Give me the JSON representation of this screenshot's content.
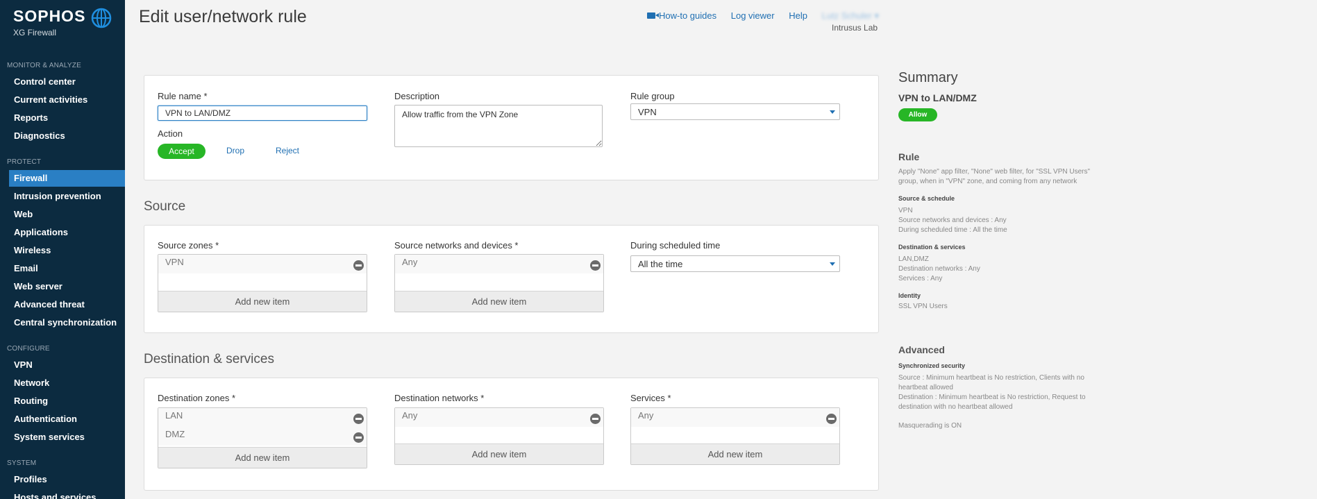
{
  "brand": {
    "logo": "SOPHOS",
    "product": "XG Firewall",
    "accent": "#2a7fc4",
    "sidebar_bg": "#0c2b40",
    "accept_green": "#27b626"
  },
  "sidebar": {
    "monitor_label": "MONITOR & ANALYZE",
    "monitor_items": [
      "Control center",
      "Current activities",
      "Reports",
      "Diagnostics"
    ],
    "protect_label": "PROTECT",
    "protect_items": [
      "Firewall",
      "Intrusion prevention",
      "Web",
      "Applications",
      "Wireless",
      "Email",
      "Web server",
      "Advanced threat",
      "Central synchronization"
    ],
    "configure_label": "CONFIGURE",
    "configure_items": [
      "VPN",
      "Network",
      "Routing",
      "Authentication",
      "System services"
    ],
    "system_label": "SYSTEM",
    "system_items": [
      "Profiles",
      "Hosts and services"
    ]
  },
  "header": {
    "title": "Edit user/network rule",
    "links": {
      "howto": "How-to guides",
      "logviewer": "Log viewer",
      "help": "Help",
      "user": "Lutz Schuler ▾"
    },
    "org": "Intrusus Lab"
  },
  "rule": {
    "name_label": "Rule name *",
    "name_value": "VPN to LAN/DMZ",
    "description_label": "Description",
    "description_value": "Allow traffic from the VPN Zone",
    "group_label": "Rule group",
    "group_value": "VPN",
    "action_label": "Action",
    "actions": {
      "accept": "Accept",
      "drop": "Drop",
      "reject": "Reject"
    }
  },
  "source": {
    "title": "Source",
    "zones_label": "Source zones *",
    "zones": [
      "VPN"
    ],
    "networks_label": "Source networks and devices *",
    "networks": [
      "Any"
    ],
    "schedule_label": "During scheduled time",
    "schedule_value": "All the time",
    "add_item": "Add new item"
  },
  "destination": {
    "title": "Destination & services",
    "zones_label": "Destination zones *",
    "zones": [
      "LAN",
      "DMZ"
    ],
    "networks_label": "Destination networks *",
    "networks": [
      "Any"
    ],
    "services_label": "Services *",
    "services": [
      "Any"
    ],
    "add_item": "Add new item"
  },
  "summary": {
    "title": "Summary",
    "rule_name": "VPN to LAN/DMZ",
    "badge": "Allow",
    "rule_heading": "Rule",
    "rule_text": "Apply \"None\" app filter, \"None\" web filter, for \"SSL VPN Users\" group, when in \"VPN\" zone, and coming from any network",
    "source_schedule_label": "Source & schedule",
    "source_lines": [
      "VPN",
      "Source networks and devices : Any",
      "During scheduled time : All the time"
    ],
    "dest_services_label": "Destination & services",
    "dest_lines": [
      "LAN,DMZ",
      "Destination networks : Any",
      "Services : Any"
    ],
    "identity_label": "Identity",
    "identity_lines": [
      "SSL VPN Users"
    ],
    "advanced_heading": "Advanced",
    "sync_label": "Synchronized security",
    "sync_lines": [
      "Source : Minimum heartbeat is No restriction, Clients with no heartbeat allowed",
      "Destination : Minimum heartbeat is No restriction, Request to destination with no heartbeat allowed"
    ],
    "masquerading": "Masquerading is ON"
  }
}
